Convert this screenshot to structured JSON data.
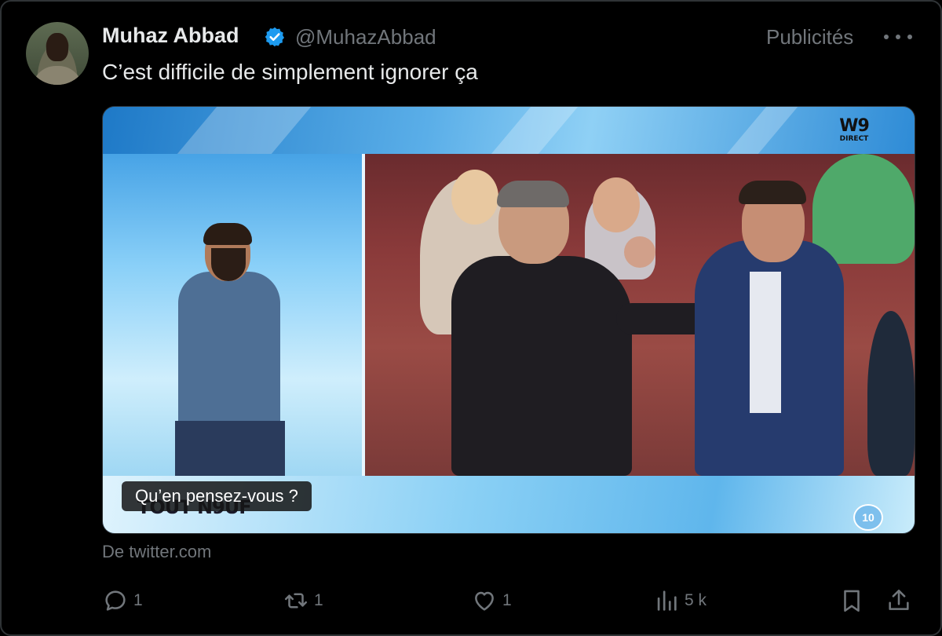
{
  "tweet": {
    "author_name": "Muhaz Abbad",
    "handle": "@MuhazAbbad",
    "promoted_label": "Publicités",
    "text": "C’est difficile de simplement ignorer ça"
  },
  "media": {
    "channel_logo_top": "W9",
    "channel_logo_bottom": "DIRECT",
    "show_title": "TOUT N9UF",
    "channel_badge": "10",
    "caption": "Qu’en pensez-vous ?"
  },
  "source": "De twitter.com",
  "actions": {
    "replies": "1",
    "reposts": "1",
    "likes": "1",
    "views": "5 k"
  },
  "colors": {
    "background": "#000000",
    "text": "#e7e9ea",
    "muted": "#71767b",
    "verified": "#1d9bf0"
  },
  "icons": {
    "verified": "verified-badge-icon",
    "more": "more-icon",
    "reply": "reply-icon",
    "repost": "repost-icon",
    "like": "heart-icon",
    "views": "views-chart-icon",
    "bookmark": "bookmark-icon",
    "share": "share-icon"
  }
}
